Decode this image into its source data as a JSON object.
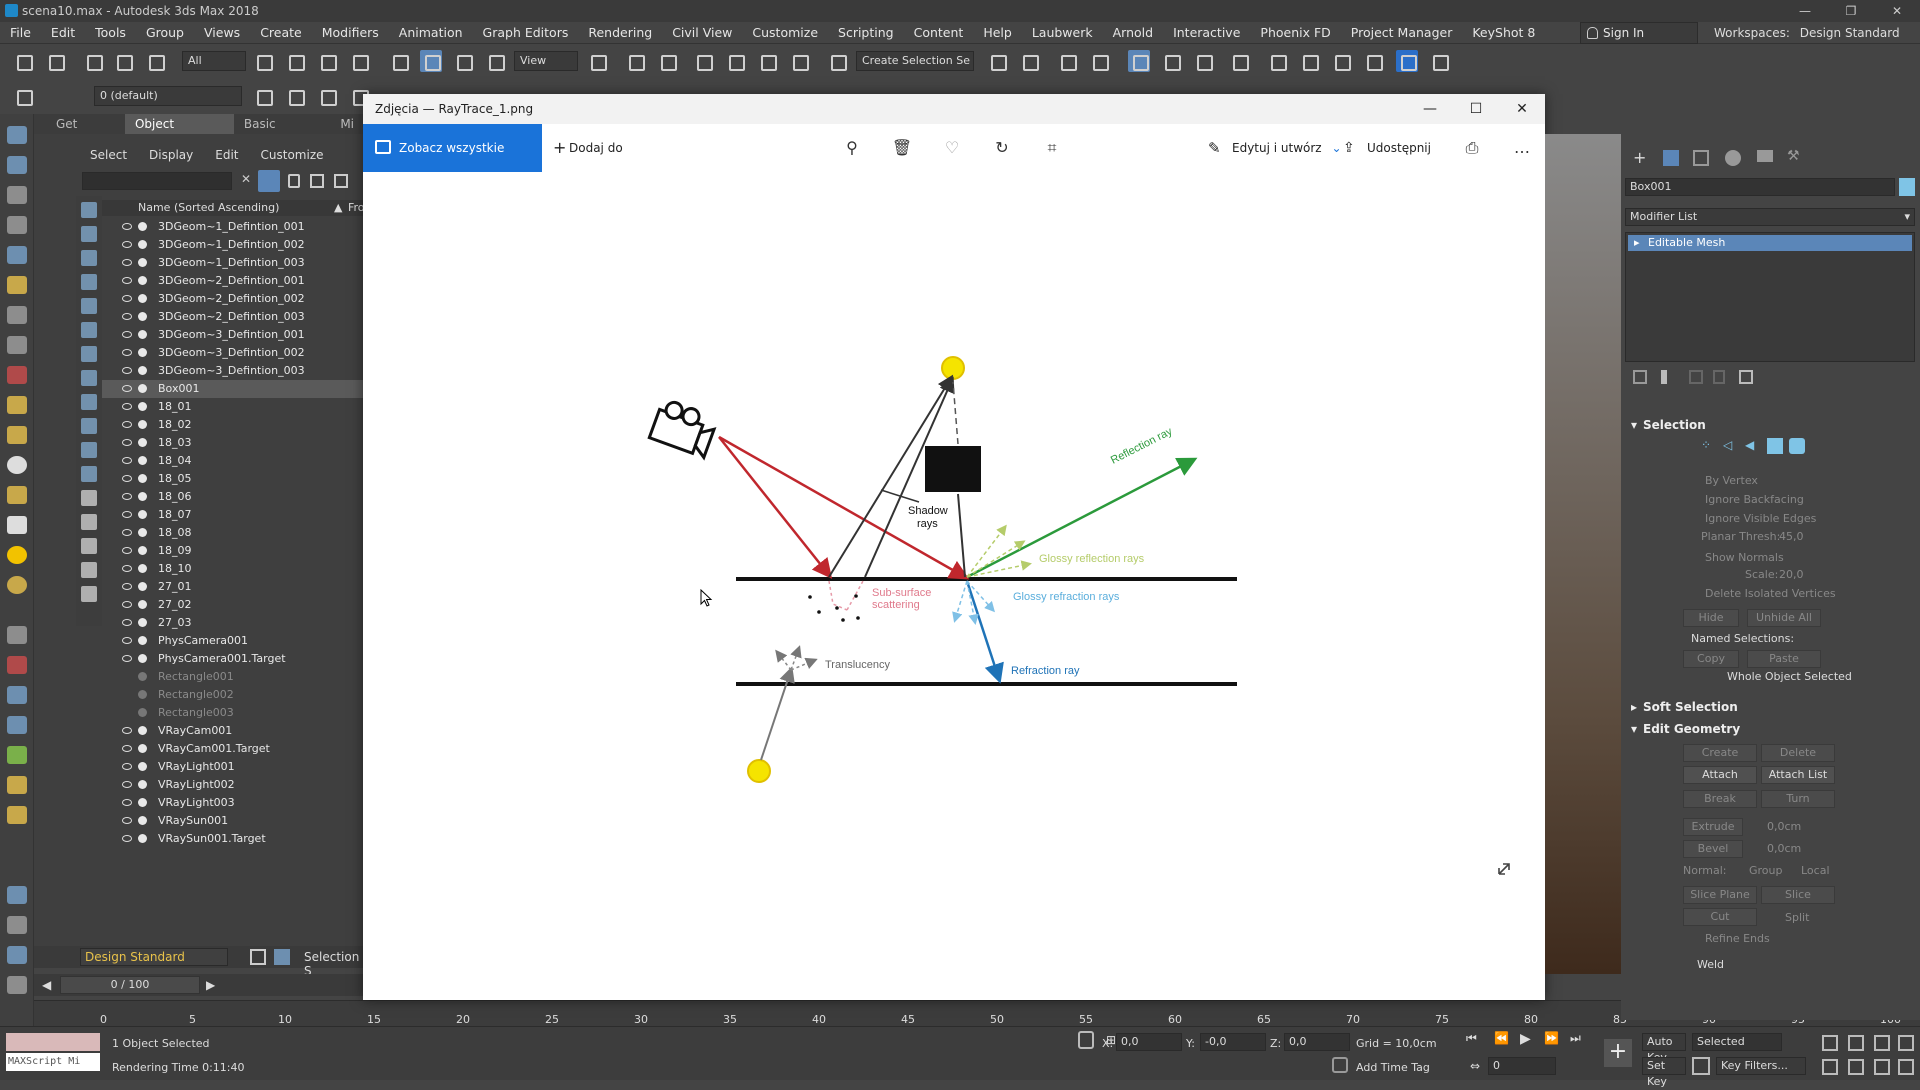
{
  "window": {
    "title": "scena10.max - Autodesk 3ds Max 2018",
    "controls": [
      "—",
      "❐",
      "✕"
    ]
  },
  "menu": [
    "File",
    "Edit",
    "Tools",
    "Group",
    "Views",
    "Create",
    "Modifiers",
    "Animation",
    "Graph Editors",
    "Rendering",
    "Civil View",
    "Customize",
    "Scripting",
    "Content",
    "Help",
    "Laubwerk",
    "Arnold",
    "Interactive",
    "Phoenix FD",
    "Project Manager",
    "KeyShot 8"
  ],
  "signin": "Sign In",
  "workspace": {
    "label": "Workspaces:",
    "value": "Design Standard"
  },
  "toolbar": {
    "filter_value": "All",
    "view_value": "View",
    "selection_set": "Create Selection Se",
    "layer_value": "0 (default)"
  },
  "ribbon_tabs": [
    "Get Started",
    "Object Inspection",
    "Basic Modeling",
    "Mi"
  ],
  "explorer": {
    "menu": [
      "Select",
      "Display",
      "Edit",
      "Customize"
    ],
    "column_header": "Name (Sorted Ascending)",
    "column_header2": "Fro",
    "rows": [
      {
        "name": "3DGeom~1_Defintion_001",
        "state": "normal"
      },
      {
        "name": "3DGeom~1_Defintion_002",
        "state": "normal"
      },
      {
        "name": "3DGeom~1_Defintion_003",
        "state": "normal"
      },
      {
        "name": "3DGeom~2_Defintion_001",
        "state": "normal"
      },
      {
        "name": "3DGeom~2_Defintion_002",
        "state": "normal"
      },
      {
        "name": "3DGeom~2_Defintion_003",
        "state": "normal"
      },
      {
        "name": "3DGeom~3_Defintion_001",
        "state": "normal"
      },
      {
        "name": "3DGeom~3_Defintion_002",
        "state": "normal"
      },
      {
        "name": "3DGeom~3_Defintion_003",
        "state": "normal"
      },
      {
        "name": "Box001",
        "state": "selected"
      },
      {
        "name": "18_01",
        "state": "normal"
      },
      {
        "name": "18_02",
        "state": "normal"
      },
      {
        "name": "18_03",
        "state": "normal"
      },
      {
        "name": "18_04",
        "state": "normal"
      },
      {
        "name": "18_05",
        "state": "normal"
      },
      {
        "name": "18_06",
        "state": "normal"
      },
      {
        "name": "18_07",
        "state": "normal"
      },
      {
        "name": "18_08",
        "state": "normal"
      },
      {
        "name": "18_09",
        "state": "normal"
      },
      {
        "name": "18_10",
        "state": "normal"
      },
      {
        "name": "27_01",
        "state": "normal"
      },
      {
        "name": "27_02",
        "state": "normal"
      },
      {
        "name": "27_03",
        "state": "normal"
      },
      {
        "name": "PhysCamera001",
        "state": "normal"
      },
      {
        "name": "PhysCamera001.Target",
        "state": "normal"
      },
      {
        "name": "Rectangle001",
        "state": "dim"
      },
      {
        "name": "Rectangle002",
        "state": "dim"
      },
      {
        "name": "Rectangle003",
        "state": "dim"
      },
      {
        "name": "VRayCam001",
        "state": "normal"
      },
      {
        "name": "VRayCam001.Target",
        "state": "normal"
      },
      {
        "name": "VRayLight001",
        "state": "normal"
      },
      {
        "name": "VRayLight002",
        "state": "normal"
      },
      {
        "name": "VRayLight003",
        "state": "normal"
      },
      {
        "name": "VRaySun001",
        "state": "normal"
      },
      {
        "name": "VRaySun001.Target",
        "state": "normal"
      }
    ],
    "layer_combo": "Design Standard",
    "selection_label": "Selection S"
  },
  "photos": {
    "title": "Zdjęcia — RayTrace_1.png",
    "view_all": "Zobacz wszystkie zdjęcia",
    "add_to": "Dodaj do",
    "edit_create": "Edytuj i utwórz",
    "share": "Udostępnij",
    "more": "…",
    "diagram_labels": {
      "reflection": "Reflection ray",
      "shadow1": "Shadow",
      "shadow2": "rays",
      "glossy_reflection": "Glossy reflection rays",
      "subsurface1": "Sub-surface",
      "subsurface2": "scattering",
      "glossy_refraction": "Glossy refraction rays",
      "translucency": "Translucency",
      "refraction": "Refraction ray"
    }
  },
  "command_panel": {
    "object_name": "Box001",
    "modifier_list": "Modifier List",
    "stack_item": "Editable Mesh",
    "selection": {
      "header": "Selection",
      "by_vertex": "By Vertex",
      "ignore_backfacing": "Ignore Backfacing",
      "ignore_visible_edges": "Ignore Visible Edges",
      "planar_thresh_label": "Planar Thresh:",
      "planar_thresh_value": "45,0",
      "show_normals": "Show Normals",
      "scale_label": "Scale:",
      "scale_value": "20,0",
      "delete_isolated": "Delete Isolated Vertices",
      "hide": "Hide",
      "unhide_all": "Unhide All",
      "named_selections": "Named Selections:",
      "copy": "Copy",
      "paste": "Paste",
      "status": "Whole Object Selected"
    },
    "soft_selection": "Soft Selection",
    "edit_geometry": {
      "header": "Edit Geometry",
      "create": "Create",
      "delete": "Delete",
      "attach": "Attach",
      "attach_list": "Attach List",
      "break": "Break",
      "turn": "Turn",
      "extrude": "Extrude",
      "extrude_value": "0,0cm",
      "bevel": "Bevel",
      "bevel_value": "0,0cm",
      "normal_label": "Normal:",
      "group": "Group",
      "local": "Local",
      "slice_plane": "Slice Plane",
      "slice": "Slice",
      "cut": "Cut",
      "split": "Split",
      "refine_ends": "Refine Ends",
      "weld": "Weld"
    }
  },
  "timeline": {
    "frame_counter": "0 / 100",
    "ticks": [
      "0",
      "5",
      "10",
      "15",
      "20",
      "25",
      "30",
      "35",
      "40",
      "45",
      "50",
      "55",
      "60",
      "65",
      "70",
      "75",
      "80",
      "85",
      "90",
      "95",
      "100"
    ]
  },
  "status": {
    "maxscript": "MAXScript Mi",
    "objects_selected": "1 Object Selected",
    "render_time": "Rendering Time  0:11:40",
    "x_label": "X:",
    "x_value": "0,0",
    "y_label": "Y:",
    "y_value": "-0,0",
    "z_label": "Z:",
    "z_value": "0,0",
    "grid": "Grid = 10,0cm",
    "add_time_tag": "Add Time Tag",
    "auto_key": "Auto Key",
    "selected": "Selected",
    "set_key": "Set Key",
    "key_filters": "Key Filters...",
    "frame": "0"
  }
}
